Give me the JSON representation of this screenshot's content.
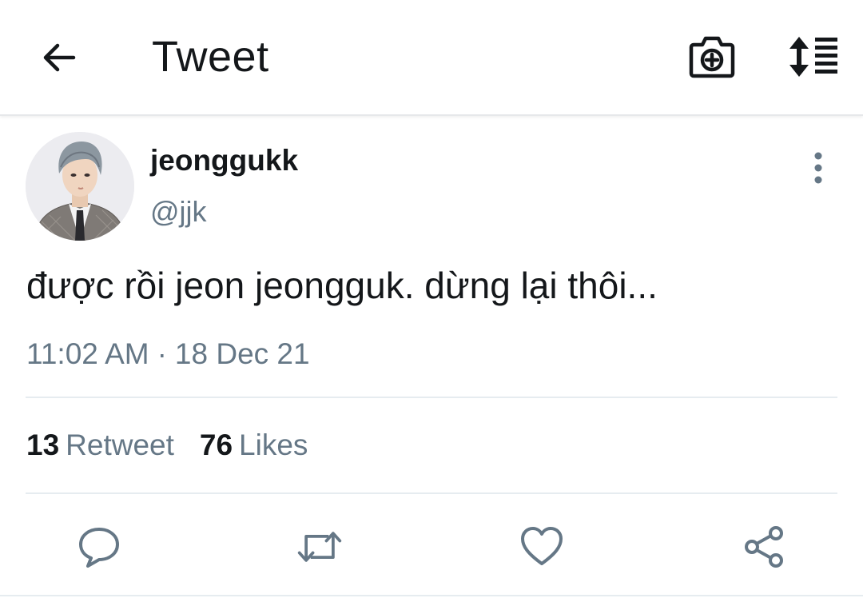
{
  "header": {
    "title": "Tweet",
    "icons": [
      "back-arrow-icon",
      "camera-plus-icon",
      "sort-lines-icon"
    ]
  },
  "tweet": {
    "display_name": "jeonggukk",
    "handle": "@jjk",
    "text": "được rồi jeon jeongguk. dừng lại thôi...",
    "time": "11:02 AM",
    "separator": "·",
    "date": "18 Dec 21",
    "retweet_count": "13",
    "retweet_label": "Retweet",
    "like_count": "76",
    "like_label": "Likes"
  },
  "actions": [
    "reply-icon",
    "retweet-icon",
    "heart-icon",
    "share-icon"
  ],
  "colors": {
    "text_primary": "#14171a",
    "text_secondary": "#657786",
    "divider": "#e6ecf0"
  }
}
